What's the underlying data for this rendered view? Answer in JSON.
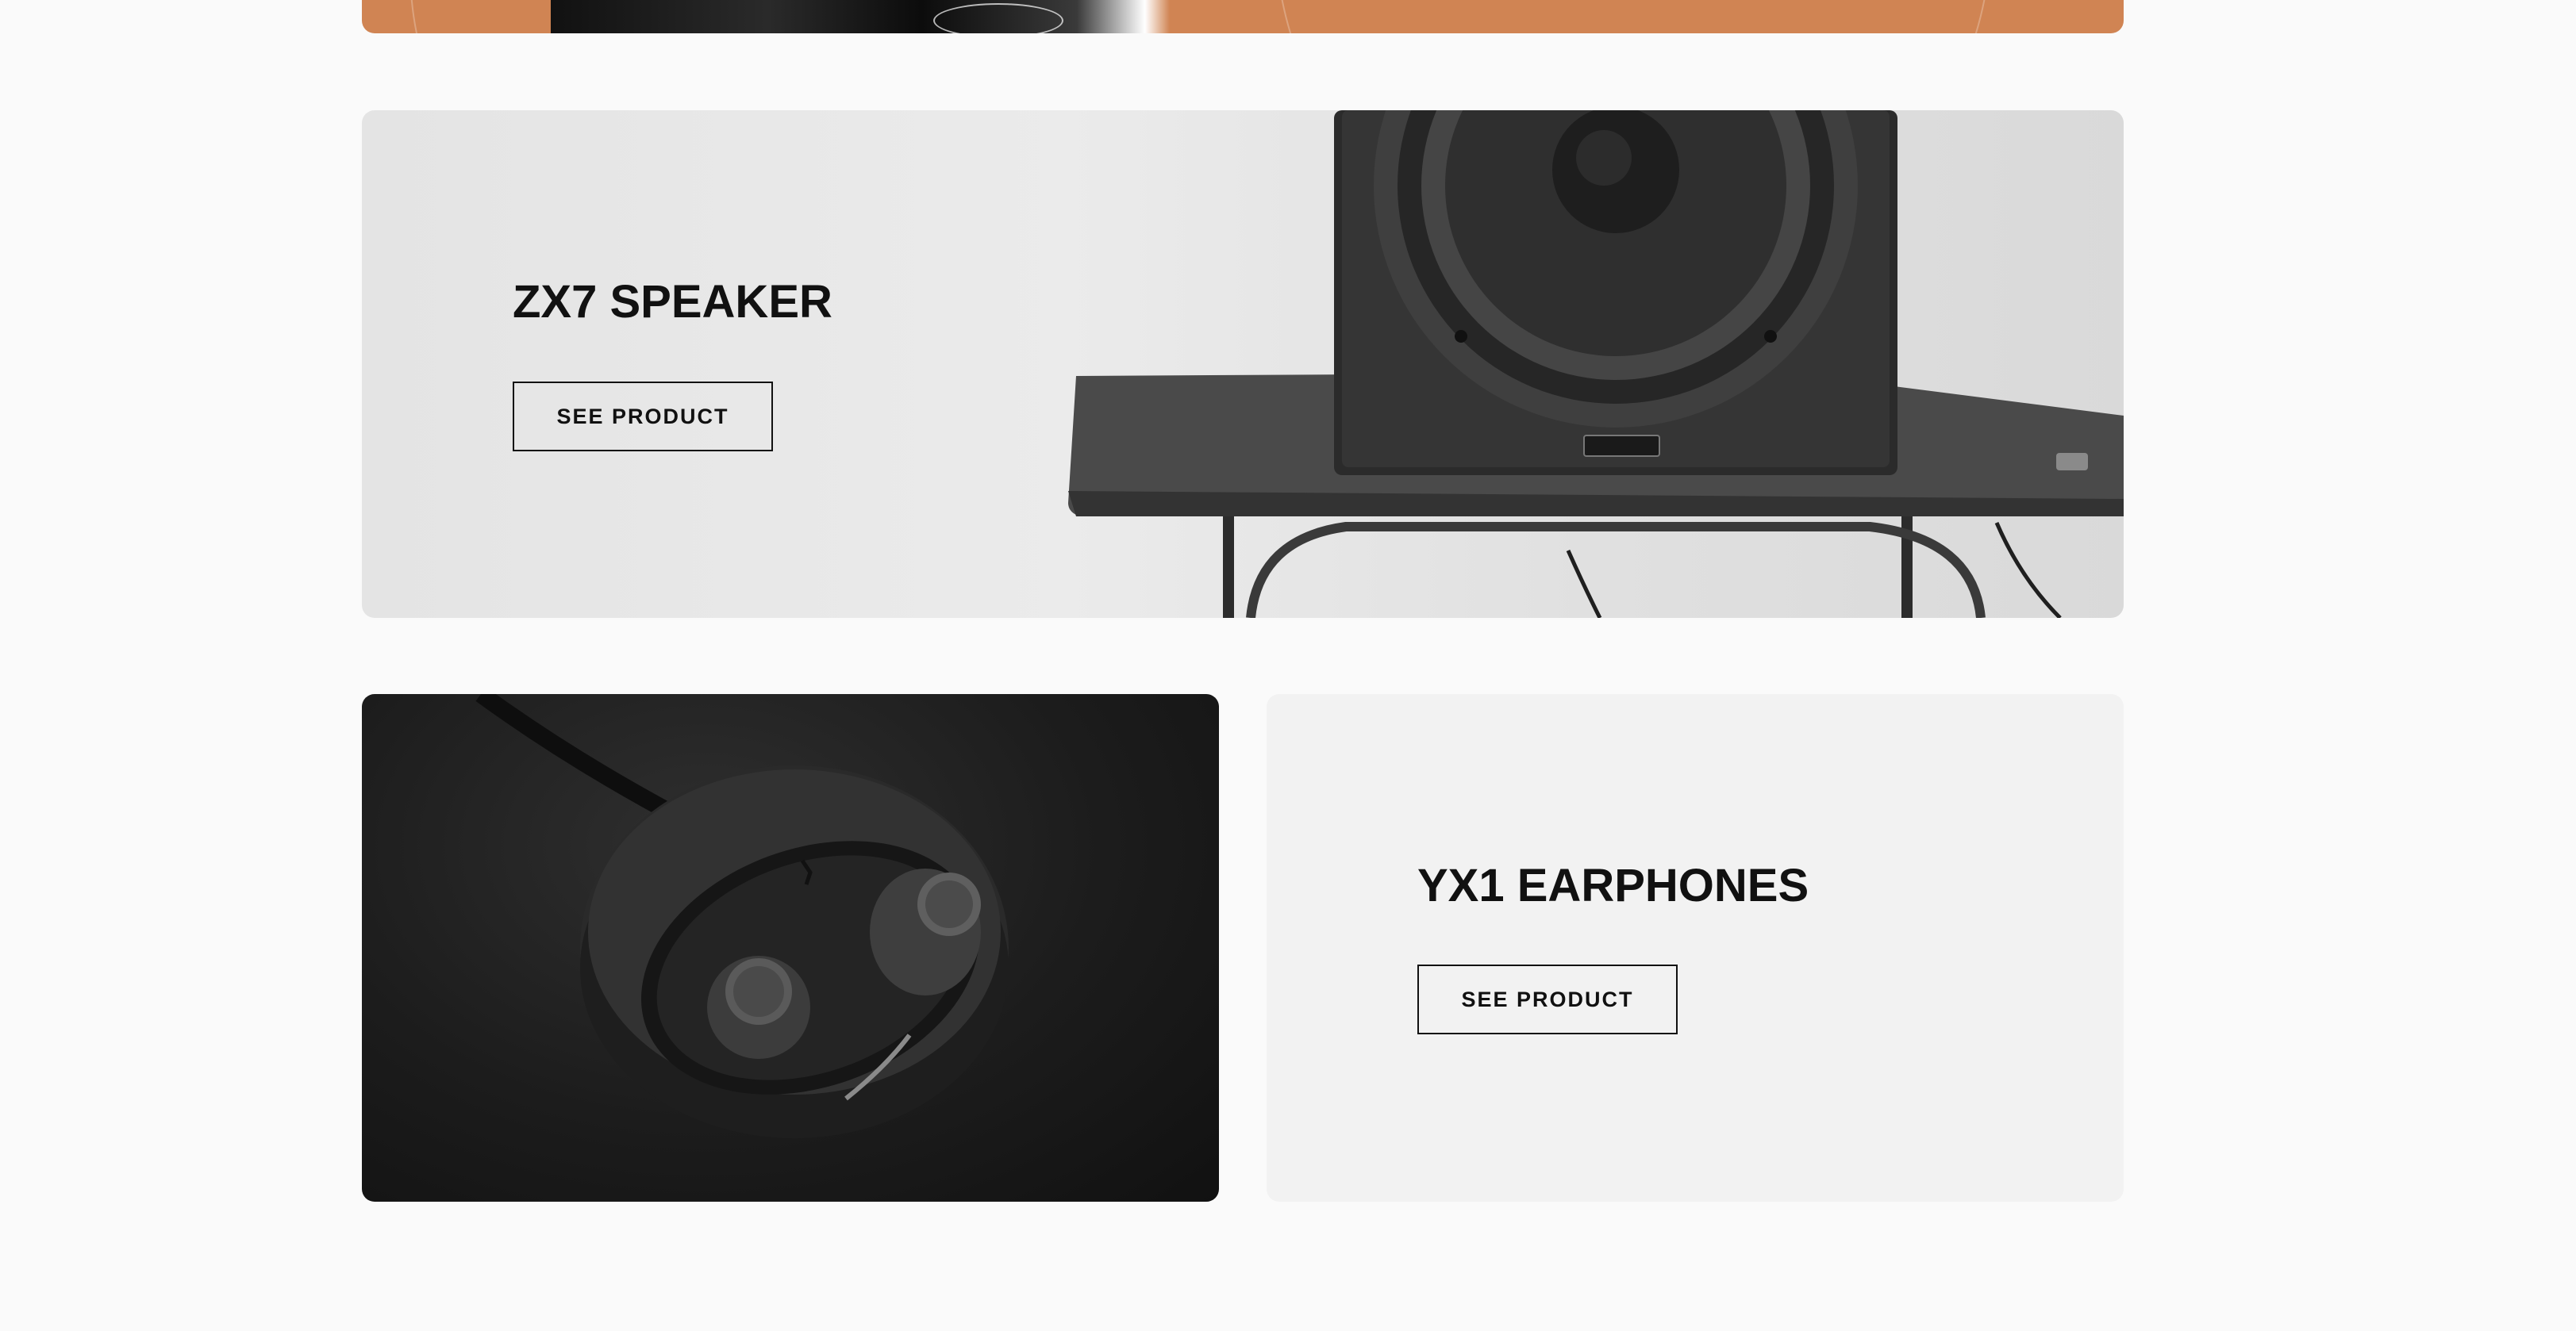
{
  "top_banner": {
    "color": "#d08453"
  },
  "zx7": {
    "title": "ZX7 SPEAKER",
    "button_label": "SEE PRODUCT"
  },
  "yx1": {
    "title": "YX1 EARPHONES",
    "button_label": "SEE PRODUCT"
  },
  "colors": {
    "page_bg": "#fafafa",
    "card_light": "#f2f2f2",
    "text_dark": "#111111",
    "accent_orange": "#d08453"
  }
}
